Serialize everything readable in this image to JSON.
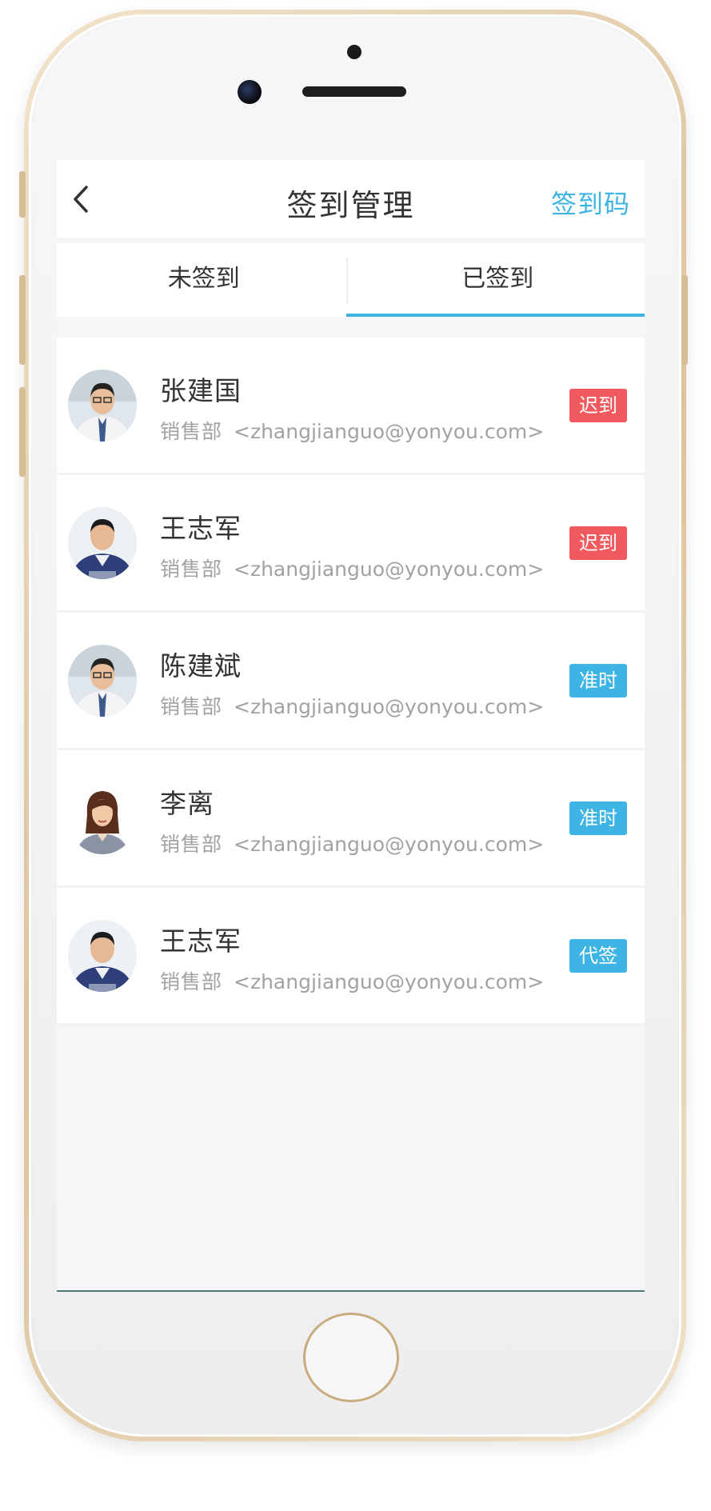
{
  "nav": {
    "title": "签到管理",
    "action": "签到码"
  },
  "tabs": [
    {
      "label": "未签到",
      "active": false
    },
    {
      "label": "已签到",
      "active": true
    }
  ],
  "colors": {
    "accent": "#3db4e4",
    "late": "#f05a5f",
    "ontime": "#3db4e4"
  },
  "rows": [
    {
      "name": "张建国",
      "dept": "销售部",
      "email": "<zhangjianguo@yonyou.com>",
      "status": "迟到",
      "status_color": "#f05a5f",
      "avatar": "man-glasses-avatar"
    },
    {
      "name": "王志军",
      "dept": "销售部",
      "email": "<zhangjianguo@yonyou.com>",
      "status": "迟到",
      "status_color": "#f05a5f",
      "avatar": "man-sweater-avatar"
    },
    {
      "name": "陈建斌",
      "dept": "销售部",
      "email": "<zhangjianguo@yonyou.com>",
      "status": "准时",
      "status_color": "#3db4e4",
      "avatar": "man-glasses-avatar"
    },
    {
      "name": "李离",
      "dept": "销售部",
      "email": "<zhangjianguo@yonyou.com>",
      "status": "准时",
      "status_color": "#3db4e4",
      "avatar": "woman-avatar"
    },
    {
      "name": "王志军",
      "dept": "销售部",
      "email": "<zhangjianguo@yonyou.com>",
      "status": "代签",
      "status_color": "#3db4e4",
      "avatar": "man-sweater-avatar"
    }
  ]
}
